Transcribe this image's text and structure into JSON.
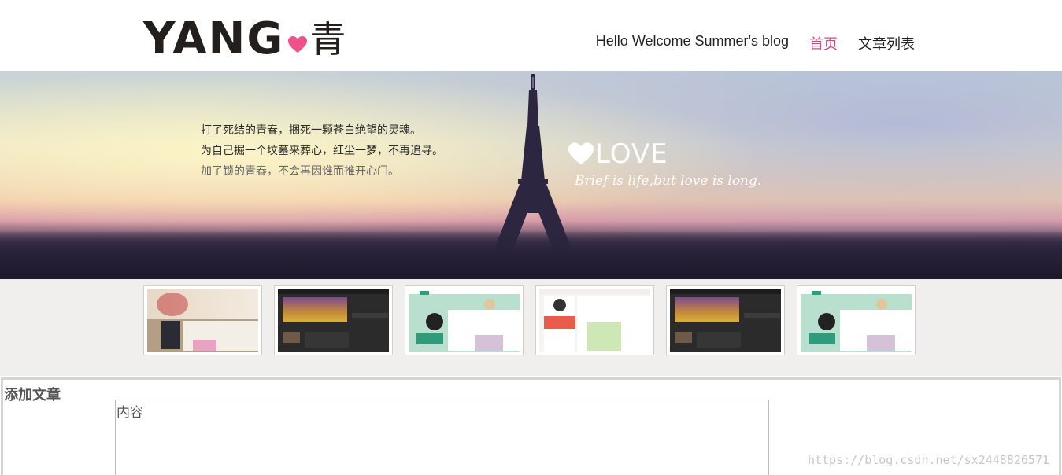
{
  "header": {
    "logo_latin": "YANG",
    "logo_cjk": "青",
    "nav": [
      {
        "label": "Hello Welcome Summer's blog",
        "active": false
      },
      {
        "label": "首页",
        "active": true
      },
      {
        "label": "文章列表",
        "active": false
      }
    ]
  },
  "banner": {
    "lines": [
      "打了死结的青春，捆死一颗苍白绝望的灵魂。",
      "为自己掘一个坟墓来葬心，红尘一梦，不再追寻。",
      "加了锁的青春，不会再因谁而推开心门。"
    ],
    "love_title": "LOVE",
    "love_subtitle": "Brief is life,but love is long."
  },
  "thumbnails": [
    {
      "style": "vintage"
    },
    {
      "style": "dark"
    },
    {
      "style": "mint"
    },
    {
      "style": "coral"
    },
    {
      "style": "dark"
    },
    {
      "style": "mint"
    }
  ],
  "form": {
    "title": "添加文章",
    "content_placeholder": "内容"
  },
  "watermark": "https://blog.csdn.net/sx2448826571",
  "colors": {
    "accent": "#e0447c",
    "logo": "#231f1c",
    "heart": "#f0508c"
  }
}
